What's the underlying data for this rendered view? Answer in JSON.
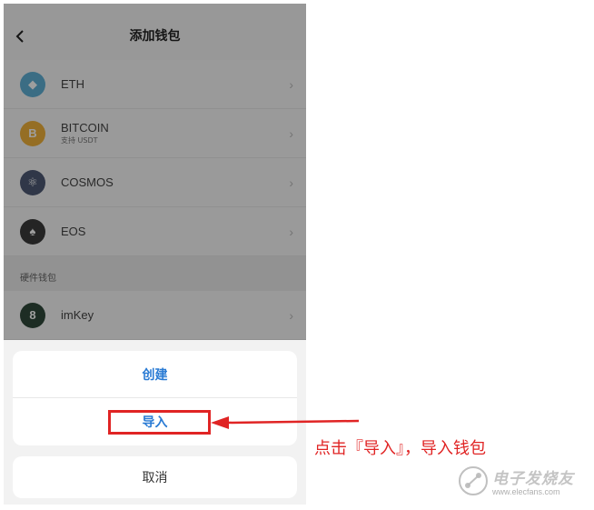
{
  "header": {
    "title": "添加钱包"
  },
  "wallets": [
    {
      "name": "ETH",
      "sub": "",
      "icon": "eth-icon",
      "icon_glyph": "◆",
      "color": "#5fb0d6"
    },
    {
      "name": "BITCOIN",
      "sub": "支持 USDT",
      "icon": "bitcoin-icon",
      "icon_glyph": "B",
      "color": "#f0b23a"
    },
    {
      "name": "COSMOS",
      "sub": "",
      "icon": "cosmos-icon",
      "icon_glyph": "⚛",
      "color": "#4e5a75"
    },
    {
      "name": "EOS",
      "sub": "",
      "icon": "eos-icon",
      "icon_glyph": "♠",
      "color": "#3b3b3b"
    }
  ],
  "hardware_section": {
    "label": "硬件钱包",
    "items": [
      {
        "name": "imKey",
        "icon": "imkey-icon",
        "icon_glyph": "8",
        "color": "#2f4a3a"
      }
    ]
  },
  "action_sheet": {
    "create_label": "创建",
    "import_label": "导入",
    "cancel_label": "取消"
  },
  "annotation": {
    "text": "点击『导入』，导入钱包",
    "color": "#e02424"
  },
  "watermark": {
    "title": "电子发烧友",
    "url": "www.elecfans.com"
  }
}
